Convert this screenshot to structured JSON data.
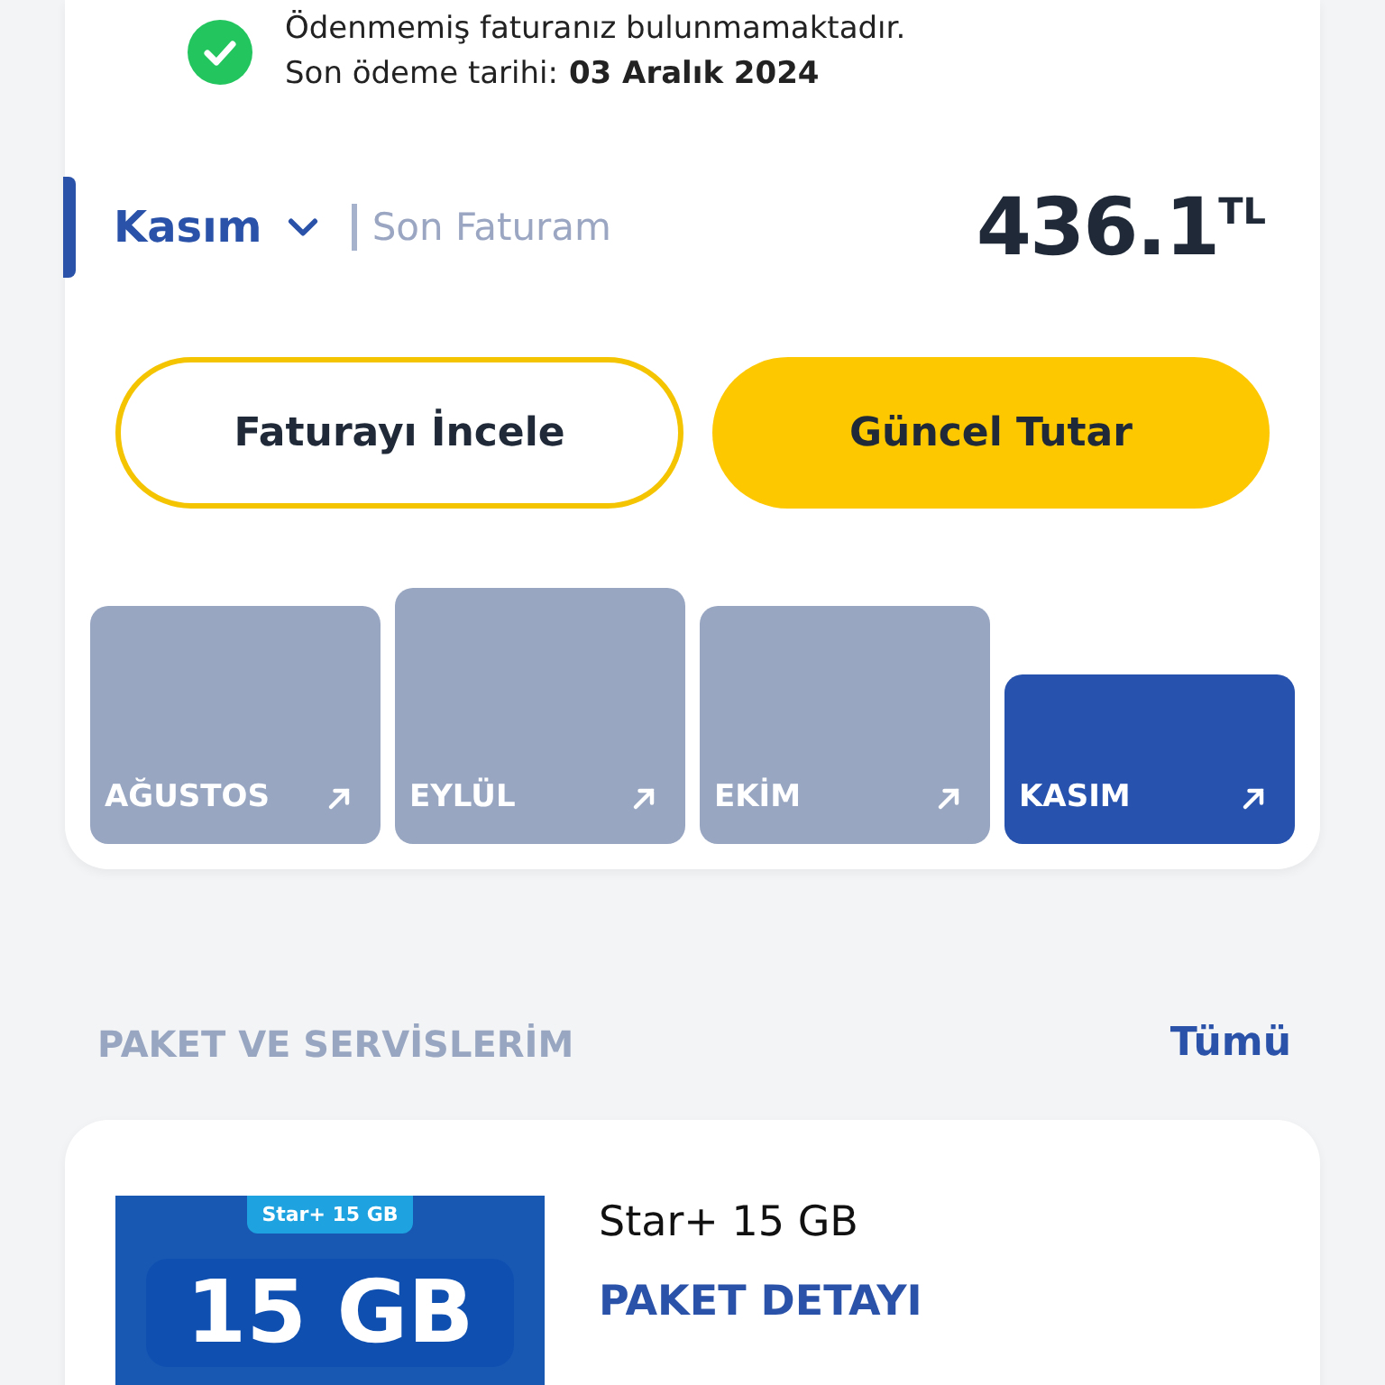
{
  "bill_status": {
    "paid": true,
    "message": "Ödenmemiş faturanız bulunmamaktadır.",
    "due_label": "Son ödeme tarihi:",
    "due_date": "03 Aralık 2024"
  },
  "bill": {
    "month": "Kasım",
    "label": "Son Faturam",
    "amount": "436.1",
    "currency": "TL"
  },
  "buttons": [
    {
      "label": "Faturayı İncele",
      "kind": "outline"
    },
    {
      "label": "Güncel Tutar",
      "kind": "filled"
    }
  ],
  "months": [
    {
      "label": "AĞUSTOS",
      "raised": false,
      "selected": false
    },
    {
      "label": "EYLÜL",
      "raised": true,
      "selected": false
    },
    {
      "label": "EKİM",
      "raised": false,
      "selected": false
    },
    {
      "label": "KASIM",
      "raised": false,
      "selected": true
    }
  ],
  "packages_section": {
    "title": "PAKET VE SERVİSLERİM",
    "link": "Tümü"
  },
  "package": {
    "banner_tag": "Star+ 15 GB",
    "banner_text": "15 GB",
    "name": "Star+ 15 GB",
    "detail_link": "PAKET DETAYI"
  }
}
